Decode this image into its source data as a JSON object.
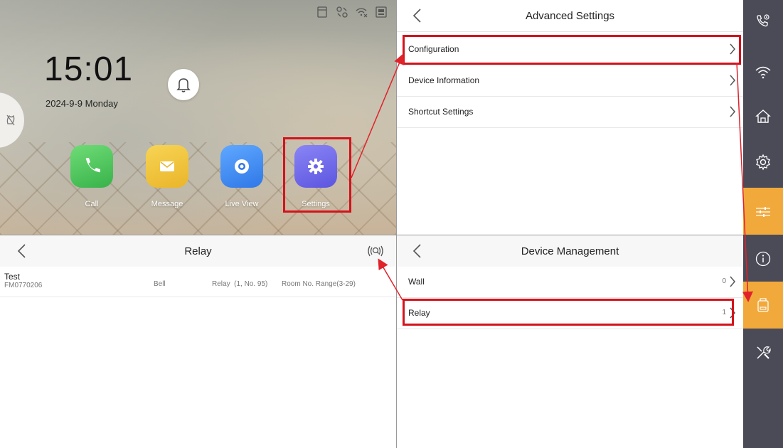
{
  "home": {
    "clock": "15:01",
    "date": "2024-9-9 Monday",
    "apps": [
      {
        "label": "Call",
        "icon": "phone-icon",
        "color": "#4cc35a"
      },
      {
        "label": "Message",
        "icon": "envelope-icon",
        "color": "#f2c23a"
      },
      {
        "label": "Live View",
        "icon": "camera-icon",
        "color": "#3f8ef0"
      },
      {
        "label": "Settings",
        "icon": "gear-icon",
        "color": "#6a63e8"
      }
    ]
  },
  "advanced_settings": {
    "title": "Advanced Settings",
    "items": [
      {
        "label": "Configuration"
      },
      {
        "label": "Device Information"
      },
      {
        "label": "Shortcut Settings"
      }
    ]
  },
  "relay_page": {
    "title": "Relay",
    "row": {
      "name": "Test",
      "serial": "FM0770206",
      "type": "Bell",
      "relay": "Relay  (1, No. 95)",
      "room_range": "Room No. Range(3-29)"
    }
  },
  "device_management": {
    "title": "Device Management",
    "items": [
      {
        "label": "Wall",
        "count": "0"
      },
      {
        "label": "Relay",
        "count": "1"
      }
    ]
  },
  "sidebar": {
    "items": [
      "phone-settings-icon",
      "wifi-icon",
      "home-icon",
      "gear-icon",
      "sliders-icon",
      "info-icon",
      "device-icon",
      "tools-icon"
    ],
    "active": [
      "sliders-icon",
      "device-icon"
    ],
    "active_color": "#f2a93b",
    "bg_color": "#4a4b57"
  },
  "colors": {
    "highlight": "#d4121b",
    "arrow": "#e0222b"
  }
}
